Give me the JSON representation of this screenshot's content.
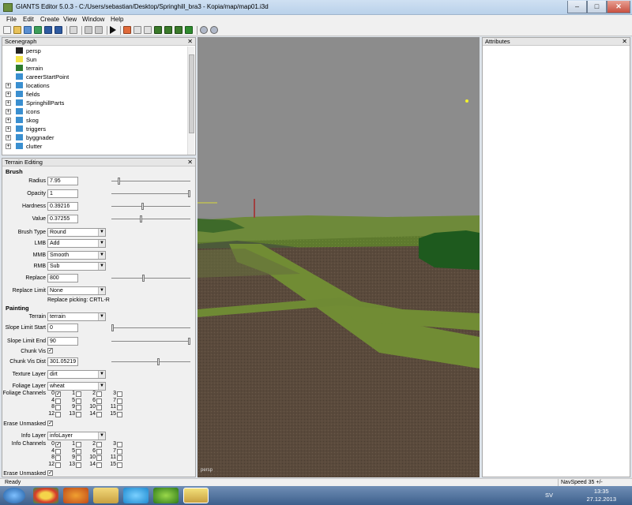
{
  "window": {
    "title": "GIANTS Editor 5.0.3 - C:/Users/sebastian/Desktop/Springhill_bra3 - Kopia/map/map01.i3d"
  },
  "menu": [
    "File",
    "Edit",
    "Create",
    "View",
    "Window",
    "Help"
  ],
  "scenegraph": {
    "title": "Scenegraph",
    "items": [
      {
        "label": "persp",
        "icon": "camera-icon",
        "color": "#222222",
        "expand": false
      },
      {
        "label": "Sun",
        "icon": "light-bulb-icon",
        "color": "#f2e34a",
        "expand": false
      },
      {
        "label": "terrain",
        "icon": "terrain-icon",
        "color": "#2e7d2e",
        "expand": false
      },
      {
        "label": "careerStartPoint",
        "icon": "transform-icon",
        "color": "#3a8fd0",
        "expand": false
      },
      {
        "label": "locations",
        "icon": "transform-icon",
        "color": "#3a8fd0",
        "expand": true
      },
      {
        "label": "fields",
        "icon": "transform-icon",
        "color": "#3a8fd0",
        "expand": true
      },
      {
        "label": "SpringhillParts",
        "icon": "transform-icon",
        "color": "#3a8fd0",
        "expand": true
      },
      {
        "label": "icons",
        "icon": "transform-icon",
        "color": "#3a8fd0",
        "expand": true
      },
      {
        "label": "skog",
        "icon": "transform-icon",
        "color": "#3a8fd0",
        "expand": true
      },
      {
        "label": "triggers",
        "icon": "transform-icon",
        "color": "#3a8fd0",
        "expand": true
      },
      {
        "label": "byggnader",
        "icon": "transform-icon",
        "color": "#3a8fd0",
        "expand": true
      },
      {
        "label": "clutter",
        "icon": "transform-icon",
        "color": "#3a8fd0",
        "expand": true
      }
    ]
  },
  "terrain_editing": {
    "title": "Terrain Editing",
    "brush": {
      "heading": "Brush",
      "radius": {
        "label": "Radius",
        "value": "7.95",
        "level": 0.08
      },
      "opacity": {
        "label": "Opacity",
        "value": "1",
        "level": 1.0
      },
      "hardness": {
        "label": "Hardness",
        "value": "0.39216",
        "level": 0.39
      },
      "value": {
        "label": "Value",
        "value": "0.37255",
        "level": 0.37
      },
      "brush_type": {
        "label": "Brush Type",
        "value": "Round"
      },
      "lmb": {
        "label": "LMB",
        "value": "Add"
      },
      "mmb": {
        "label": "MMB",
        "value": "Smooth"
      },
      "rmb": {
        "label": "RMB",
        "value": "Sub"
      },
      "replace": {
        "label": "Replace",
        "value": "800",
        "level": 0.4
      },
      "replace_limit": {
        "label": "Replace Limit",
        "value": "None"
      },
      "replace_hint": "Replace picking: CRTL-R"
    },
    "painting": {
      "heading": "Painting",
      "terrain": {
        "label": "Terrain",
        "value": "terrain"
      },
      "slope_start": {
        "label": "Slope Limit Start",
        "value": "0",
        "level": 0.0
      },
      "slope_end": {
        "label": "Slope Limit End",
        "value": "90",
        "level": 1.0
      },
      "chunk_vis": {
        "label": "Chunk Vis"
      },
      "chunk_vis_dist": {
        "label": "Chunk Vis Dist",
        "value": "301.05219",
        "level": 0.6
      },
      "texture_layer": {
        "label": "Texture Layer",
        "value": "dirt"
      },
      "foliage_layer": {
        "label": "Foliage Layer",
        "value": "wheat"
      },
      "foliage_channels": {
        "label": "Foliage Channels",
        "checked": [
          0
        ]
      },
      "erase_unmasked_1": {
        "label": "Erase Unmasked"
      },
      "info_layer": {
        "label": "Info Layer",
        "value": "infoLayer"
      },
      "info_channels": {
        "label": "Info Channels",
        "checked": [
          0
        ]
      },
      "erase_unmasked_2": {
        "label": "Erase Unmasked"
      }
    },
    "channels": [
      "0",
      "1",
      "2",
      "3",
      "4",
      "5",
      "6",
      "7",
      "8",
      "9",
      "10",
      "11",
      "12",
      "13",
      "14",
      "15"
    ]
  },
  "attributes": {
    "title": "Attributes"
  },
  "viewport": {
    "label": "persp"
  },
  "status": {
    "left": "Ready",
    "navspeed": "NavSpeed 35 +/-"
  },
  "taskbar": {
    "lang": "SV",
    "time": "13:35",
    "date": "27.12.2013"
  }
}
